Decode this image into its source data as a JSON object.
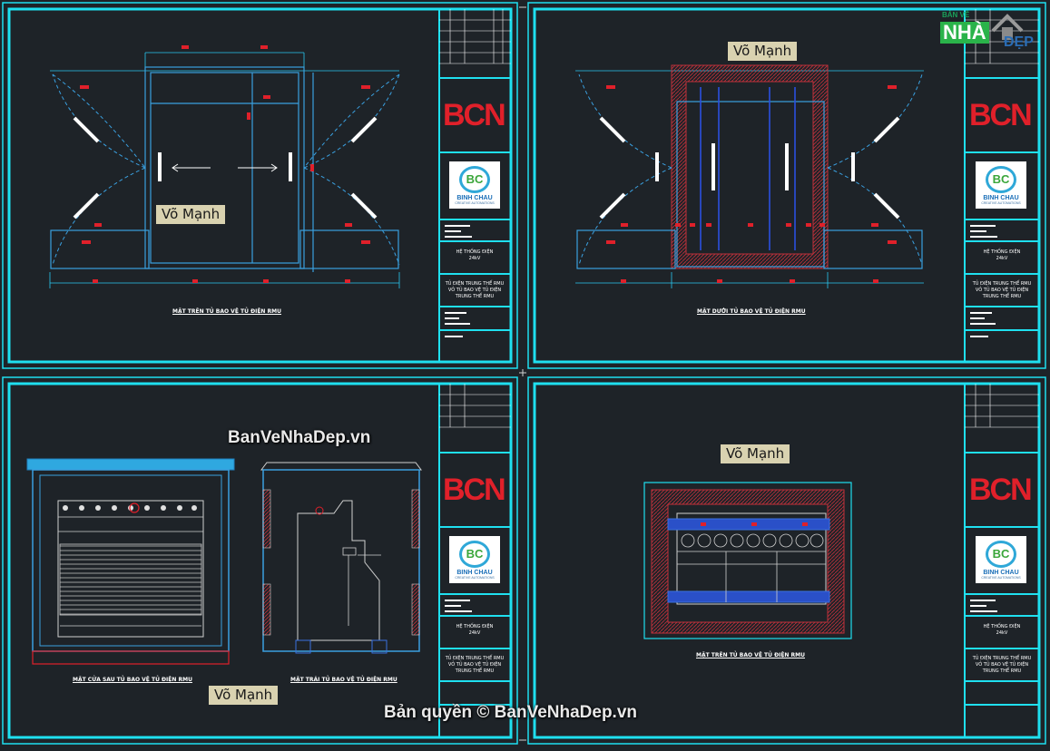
{
  "watermarks": {
    "tag_top_left": "Võ Mạnh",
    "tag_top_right": "Võ Mạnh",
    "tag_bottom_left": "Võ Mạnh",
    "tag_bottom_right": "Võ Mạnh",
    "site_url": "BanVeNhaDep.vn",
    "copyright": "Bản quyền © BanVeNhaDep.vn"
  },
  "site_logo": {
    "small_text": "BẢN VẼ",
    "main_text": "NHÀ",
    "accent_text": "ĐẸP"
  },
  "captions": {
    "top_left": "MẶT TRÊN TỦ BAO VỆ TỦ ĐIỆN RMU",
    "top_right": "MẶT DƯỚI TỦ BAO VỆ TỦ ĐIỆN RMU",
    "bottom_left_a": "MẶT CỬA SAU TỦ BAO VỆ TỦ ĐIỆN RMU",
    "bottom_left_b": "MẶT TRÁI TỦ BAO VỆ TỦ ĐIỆN RMU",
    "bottom_right": "MẶT TRÊN TỦ BAO VỆ TỦ ĐIỆN RMU"
  },
  "title_block": {
    "company_logo": "BCN",
    "badge_mark": "BC",
    "badge_name": "BINH CHAU",
    "badge_slogan": "CREATIVE AUTOMATIONS",
    "system_line1": "HỆ THỐNG ĐIỆN",
    "system_line2": "24kV",
    "desc_line1": "TỦ ĐIỆN TRUNG THẾ RMU",
    "desc_line2": "VỎ TỦ BAO VỆ TỦ ĐIỆN",
    "desc_line3": "TRUNG THẾ RMU"
  },
  "colors": {
    "background": "#1e2328",
    "frame": "#1fe0f0",
    "drawing_line": "#3aa0e0",
    "dimension": "#28c8f0",
    "marker": "#e0202a",
    "logo_red": "#e0202a"
  }
}
